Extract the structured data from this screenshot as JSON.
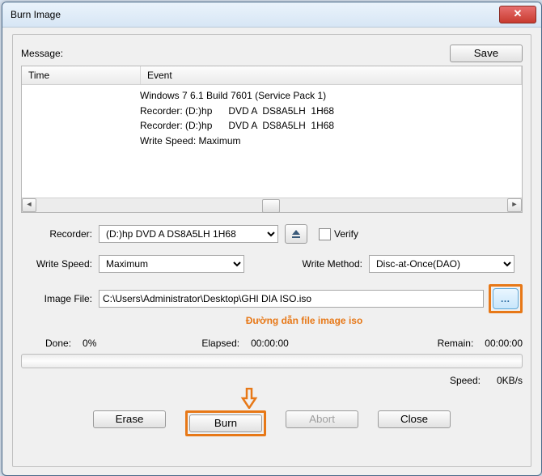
{
  "window": {
    "title": "Burn Image",
    "close_glyph": "✕"
  },
  "topbar": {
    "message_label": "Message:",
    "save": "Save"
  },
  "listview": {
    "col_time": "Time",
    "col_event": "Event",
    "events": [
      "Windows 7 6.1 Build 7601 (Service Pack 1)",
      "Recorder: (D:)hp      DVD A  DS8A5LH  1H68",
      "Recorder: (D:)hp      DVD A  DS8A5LH  1H68",
      "Write Speed: Maximum"
    ]
  },
  "recorder": {
    "label": "Recorder:",
    "value": "(D:)hp      DVD A  DS8A5LH  1H68",
    "verify_label": "Verify"
  },
  "write_speed": {
    "label": "Write Speed:",
    "value": "Maximum"
  },
  "write_method": {
    "label": "Write Method:",
    "value": "Disc-at-Once(DAO)"
  },
  "image_file": {
    "label": "Image File:",
    "value": "C:\\Users\\Administrator\\Desktop\\GHI DIA ISO.iso",
    "browse_glyph": "…"
  },
  "annotation": "Đường dẫn file image iso",
  "progress": {
    "done_label": "Done:",
    "done_value": "0%",
    "elapsed_label": "Elapsed:",
    "elapsed_value": "00:00:00",
    "remain_label": "Remain:",
    "remain_value": "00:00:00",
    "speed_label": "Speed:",
    "speed_value": "0KB/s"
  },
  "buttons": {
    "erase": "Erase",
    "burn": "Burn",
    "abort": "Abort",
    "close": "Close"
  },
  "icons": {
    "eject_tooltip": "eject"
  }
}
